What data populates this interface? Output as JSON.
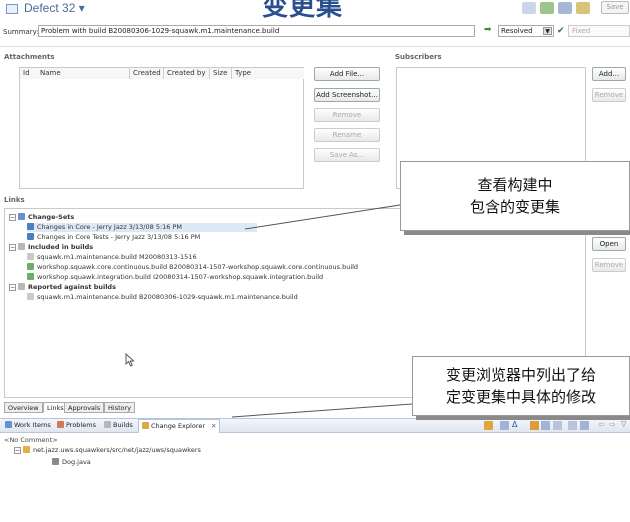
{
  "banner": {
    "title": "变更集"
  },
  "header": {
    "title": "Defect 32 ▾",
    "save_label": "Save"
  },
  "summary": {
    "label": "Summary:*",
    "value": "Problem with build B20080306-1029-squawk.m1.maintenance.build",
    "state": "Resolved",
    "resolution": "Fixed"
  },
  "attachments": {
    "title": "Attachments",
    "columns": [
      "Id",
      "Name",
      "Created",
      "Created by",
      "Size",
      "Type"
    ],
    "buttons": {
      "add_file": "Add File...",
      "add_screenshot": "Add Screenshot...",
      "remove": "Remove",
      "rename": "Rename",
      "save_as": "Save As..."
    }
  },
  "subscribers": {
    "title": "Subscribers",
    "buttons": {
      "add": "Add...",
      "remove": "Remove"
    }
  },
  "links": {
    "title": "Links",
    "buttons": {
      "open": "Open",
      "remove": "Remove"
    },
    "groups": [
      {
        "label": "Change-Sets",
        "items": [
          "Changes in Core - Jerry Jazz 3/13/08 5:16 PM",
          "Changes in Core Tests - Jerry Jazz 3/13/08 5:16 PM"
        ]
      },
      {
        "label": "Included in builds",
        "items": [
          "squawk.m1.maintenance.build M20080313-1516",
          "workshop.squawk.core.continuous.build B20080314-1507-workshop.squawk.core.continuous.build",
          "workshop.squawk.integration.build I20080314-1507-workshop.squawk.integration.build"
        ]
      },
      {
        "label": "Reported against builds",
        "items": [
          "squawk.m1.maintenance.build B20080306-1029-squawk.m1.maintenance.build"
        ]
      }
    ]
  },
  "callouts": {
    "top": [
      "查看构建中",
      "包含的变更集"
    ],
    "bottom": [
      "变更浏览器中列出了给",
      "定变更集中具体的修改"
    ]
  },
  "editor_tabs": [
    "Overview",
    "Links",
    "Approvals",
    "History"
  ],
  "views": {
    "tabs": [
      "Work Items",
      "Problems",
      "Builds",
      "Change Explorer"
    ],
    "comment": "<No Comment>",
    "tree": {
      "folder": "net.jazz.uws.squawkers/src/net/jazz/uws/squawkers",
      "file": "Dog.java"
    }
  },
  "colors": {
    "accent": "#2a4f8f",
    "header_text": "#4a6a98",
    "selection": "#dde8f7"
  }
}
